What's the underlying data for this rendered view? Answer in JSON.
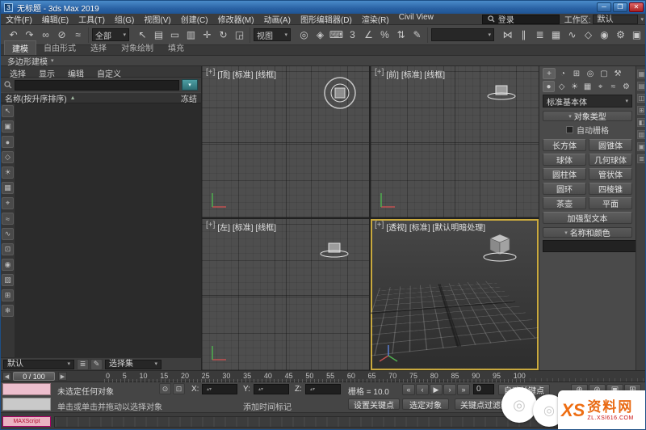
{
  "window": {
    "title": "无标题 - 3ds Max 2019",
    "min_glyph": "─",
    "max_glyph": "❐",
    "close_glyph": "✕",
    "logo_glyph": "3"
  },
  "menubar": {
    "menus": [
      "文件(F)",
      "编辑(E)",
      "工具(T)",
      "组(G)",
      "视图(V)",
      "创建(C)",
      "修改器(M)",
      "动画(A)",
      "图形编辑器(D)",
      "渲染(R)",
      "Civil View"
    ],
    "signin": "登录",
    "workspace_label": "工作区:",
    "workspace_value": "默认"
  },
  "toolbar": {
    "icons1": [
      {
        "name": "undo-icon",
        "glyph": "↶"
      },
      {
        "name": "redo-icon",
        "glyph": "↷"
      },
      {
        "name": "select-and-link-icon",
        "glyph": "∞"
      },
      {
        "name": "unlink-selection-icon",
        "glyph": "⊘"
      },
      {
        "name": "bind-to-spacewarp-icon",
        "glyph": "≈"
      }
    ],
    "selection_filter": "全部",
    "icons2": [
      {
        "name": "select-object-icon",
        "glyph": "↖"
      },
      {
        "name": "select-by-name-icon",
        "glyph": "▤"
      },
      {
        "name": "selection-region-icon",
        "glyph": "▭"
      },
      {
        "name": "window-crossing-icon",
        "glyph": "▥"
      },
      {
        "name": "select-and-move-icon",
        "glyph": "✛"
      },
      {
        "name": "select-and-rotate-icon",
        "glyph": "↻"
      },
      {
        "name": "select-and-scale-icon",
        "glyph": "◲"
      }
    ],
    "coord_system": "视图",
    "icons3": [
      {
        "name": "use-pivot-center-icon",
        "glyph": "◎"
      },
      {
        "name": "select-and-manipulate-icon",
        "glyph": "◈"
      },
      {
        "name": "keyboard-override-icon",
        "glyph": "⌨"
      },
      {
        "name": "snaps-toggle-icon",
        "glyph": "3"
      },
      {
        "name": "angle-snap-icon",
        "glyph": "∠"
      },
      {
        "name": "percent-snap-icon",
        "glyph": "%"
      },
      {
        "name": "spinner-snap-icon",
        "glyph": "⇅"
      },
      {
        "name": "edit-named-sets-icon",
        "glyph": "✎"
      }
    ],
    "icons4": [
      {
        "name": "mirror-icon",
        "glyph": "⋈"
      },
      {
        "name": "align-icon",
        "glyph": "∥"
      },
      {
        "name": "layer-manager-icon",
        "glyph": "≣"
      },
      {
        "name": "ribbon-toggle-icon",
        "glyph": "▦"
      },
      {
        "name": "curve-editor-icon",
        "glyph": "∿"
      },
      {
        "name": "schematic-view-icon",
        "glyph": "◇"
      },
      {
        "name": "material-editor-icon",
        "glyph": "◉"
      },
      {
        "name": "render-setup-icon",
        "glyph": "⚙"
      },
      {
        "name": "rendered-frame-icon",
        "glyph": "▣"
      },
      {
        "name": "render-production-icon",
        "glyph": "☕"
      }
    ]
  },
  "ribbon": {
    "tabs": [
      "建模",
      "自由形式",
      "选择",
      "对象绘制",
      "填充"
    ],
    "panel_label": "多边形建模"
  },
  "explorer": {
    "menu_tabs": [
      "选择",
      "显示",
      "编辑",
      "自定义"
    ],
    "name_header": "名称(按升序排序)",
    "sort_arrow": "▲",
    "frozen_header": "冻结",
    "side_icons": [
      {
        "name": "explorer-select-icon",
        "glyph": "↖"
      },
      {
        "name": "display-all-icon",
        "glyph": "▣"
      },
      {
        "name": "display-geometry-icon",
        "glyph": "●"
      },
      {
        "name": "display-shapes-icon",
        "glyph": "◇"
      },
      {
        "name": "display-lights-icon",
        "glyph": "☀"
      },
      {
        "name": "display-cameras-icon",
        "glyph": "▦"
      },
      {
        "name": "display-helpers-icon",
        "glyph": "⌖"
      },
      {
        "name": "display-spacewarps-icon",
        "glyph": "≈"
      },
      {
        "name": "display-bones-icon",
        "glyph": "∿"
      },
      {
        "name": "display-containers-icon",
        "glyph": "⊡"
      },
      {
        "name": "display-materials-icon",
        "glyph": "◉"
      },
      {
        "name": "display-groups-icon",
        "glyph": "▧"
      },
      {
        "name": "display-xrefs-icon",
        "glyph": "⊞"
      },
      {
        "name": "display-frozen-icon",
        "glyph": "❄"
      }
    ]
  },
  "selection_sets": {
    "value": "默认",
    "label": "选择集",
    "icons": [
      {
        "name": "named-sets-list-icon",
        "glyph": "≣"
      },
      {
        "name": "named-sets-edit-icon",
        "glyph": "✎"
      }
    ]
  },
  "viewports": {
    "top": {
      "menu_btn": "[+]",
      "name": "[顶]",
      "style": "[标准]",
      "shade": "[线框]"
    },
    "front": {
      "menu_btn": "[+]",
      "name": "[前]",
      "style": "[标准]",
      "shade": "[线框]"
    },
    "left": {
      "menu_btn": "[+]",
      "name": "[左]",
      "style": "[标准]",
      "shade": "[线框]"
    },
    "persp": {
      "menu_btn": "[+]",
      "name": "[透视]",
      "style": "[标准]",
      "shade": "[默认明暗处理]"
    }
  },
  "timeline": {
    "handle": "0 / 100",
    "prev_glyph": "◀",
    "next_glyph": "▶",
    "ticks": [
      "0",
      "5",
      "10",
      "15",
      "20",
      "25",
      "30",
      "35",
      "40",
      "45",
      "50",
      "55",
      "60",
      "65",
      "70",
      "75",
      "80",
      "85",
      "90",
      "95",
      "100"
    ]
  },
  "status": {
    "maxscript_label": "MAXScript",
    "line1": "未选定任何对象",
    "line2": "单击或单击并拖动以选择对象",
    "icons": [
      {
        "name": "isolate-selection-icon",
        "glyph": "⊙"
      },
      {
        "name": "selection-lock-icon",
        "glyph": "⊡"
      }
    ],
    "x_label": "X:",
    "y_label": "Y:",
    "z_label": "Z:",
    "grid_label": "栅格 = 10.0",
    "time_tag": "添加时间标记"
  },
  "animation": {
    "auto_key": "自动关键点",
    "set_key": "设置关键点",
    "selected_filter": "选定对象",
    "key_filters": "关键点过滤器...",
    "frame": "0",
    "playback": [
      {
        "name": "go-to-start-icon",
        "glyph": "«"
      },
      {
        "name": "previous-frame-icon",
        "glyph": "‹"
      },
      {
        "name": "play-icon",
        "glyph": "▶"
      },
      {
        "name": "next-frame-icon",
        "glyph": "›"
      },
      {
        "name": "go-to-end-icon",
        "glyph": "»"
      }
    ],
    "nav_row1": [
      {
        "name": "zoom-icon",
        "glyph": "⊕"
      },
      {
        "name": "zoom-all-icon",
        "glyph": "⊛"
      },
      {
        "name": "zoom-extents-icon",
        "glyph": "▣"
      },
      {
        "name": "zoom-extents-all-icon",
        "glyph": "⊞"
      }
    ],
    "nav_row2": [
      {
        "name": "zoom-region-icon",
        "glyph": "▭"
      },
      {
        "name": "pan-icon",
        "glyph": "✛"
      },
      {
        "name": "orbit-icon",
        "glyph": "↻"
      },
      {
        "name": "maximize-viewport-icon",
        "glyph": "◱"
      }
    ]
  },
  "command_panel": {
    "tabs": [
      {
        "name": "create-tab-icon",
        "glyph": "+"
      },
      {
        "name": "modify-tab-icon",
        "glyph": "◔"
      },
      {
        "name": "hierarchy-tab-icon",
        "glyph": "⊞"
      },
      {
        "name": "motion-tab-icon",
        "glyph": "◎"
      },
      {
        "name": "display-tab-icon",
        "glyph": "▢"
      },
      {
        "name": "utilities-tab-icon",
        "glyph": "⚒"
      }
    ],
    "categories": [
      {
        "name": "geometry-category-icon",
        "glyph": "●"
      },
      {
        "name": "shapes-category-icon",
        "glyph": "◇"
      },
      {
        "name": "lights-category-icon",
        "glyph": "☀"
      },
      {
        "name": "cameras-category-icon",
        "glyph": "▦"
      },
      {
        "name": "helpers-category-icon",
        "glyph": "⌖"
      },
      {
        "name": "spacewarps-category-icon",
        "glyph": "≈"
      },
      {
        "name": "systems-category-icon",
        "glyph": "⚙"
      }
    ],
    "dropdown_value": "标准基本体",
    "object_type_rollout": "对象类型",
    "autogrid_label": "自动栅格",
    "object_buttons": [
      "长方体",
      "圆锥体",
      "球体",
      "几何球体",
      "圆柱体",
      "管状体",
      "圆环",
      "四棱锥",
      "茶壶",
      "平面",
      "加强型文本"
    ],
    "name_color_rollout": "名称和颜色",
    "swatch_color": "#e332c6"
  },
  "right_dock": {
    "icons": [
      {
        "name": "dock-icon-1",
        "glyph": "▦"
      },
      {
        "name": "dock-icon-2",
        "glyph": "▤"
      },
      {
        "name": "dock-icon-3",
        "glyph": "◫"
      },
      {
        "name": "dock-icon-4",
        "glyph": "⊞"
      },
      {
        "name": "dock-icon-5",
        "glyph": "◧"
      },
      {
        "name": "dock-icon-6",
        "glyph": "▥"
      },
      {
        "name": "dock-icon-7",
        "glyph": "▣"
      },
      {
        "name": "dock-icon-8",
        "glyph": "≣"
      }
    ]
  },
  "watermark": {
    "logo": "XS",
    "site": "资料网",
    "url": "ZL.XSl616.COM"
  }
}
